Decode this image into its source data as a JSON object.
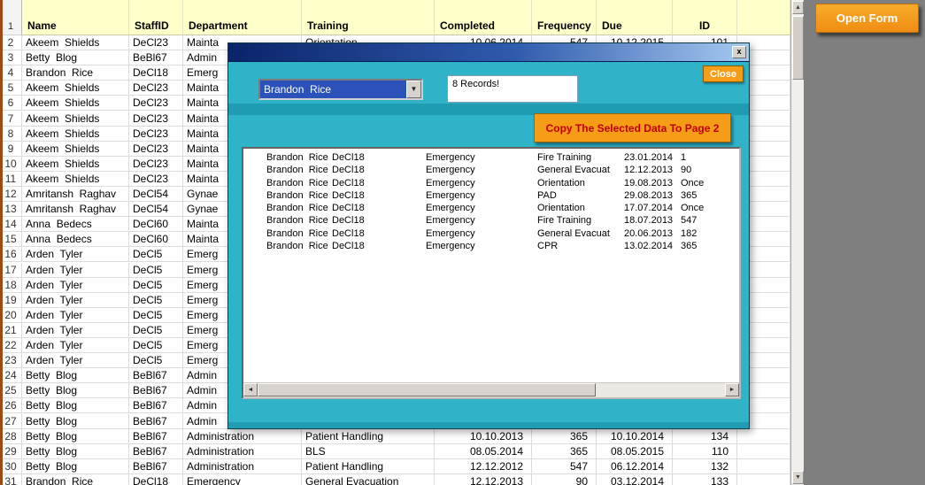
{
  "colors": {
    "accent_orange": "#f59d17",
    "dialog_teal": "#2fb3c9",
    "stripe_teal": "#1f9cb1",
    "selection_blue": "#2a52b8",
    "header_yellow": "#ffffc9",
    "copy_button_text": "#c00000"
  },
  "open_form": {
    "label": "Open Form"
  },
  "sheet": {
    "header_row_num": "1",
    "columns": [
      "Name",
      "StaffID",
      "Department",
      "Training",
      "Completed",
      "Frequency",
      "Due",
      "ID"
    ],
    "rows": [
      {
        "n": "2",
        "name": "Akeem  Shields",
        "staff": "DeCl23",
        "dept": "Mainta",
        "training": "Orientation",
        "completed": "10.06.2014",
        "frequency": "547",
        "due": "10.12.2015",
        "id": "101"
      },
      {
        "n": "3",
        "name": "Betty  Blog",
        "staff": "BeBl67",
        "dept": "Admin",
        "training": "",
        "completed": "",
        "frequency": "",
        "due": "",
        "id": ""
      },
      {
        "n": "4",
        "name": "Brandon  Rice",
        "staff": "DeCl18",
        "dept": "Emerg",
        "training": "",
        "completed": "",
        "frequency": "",
        "due": "",
        "id": ""
      },
      {
        "n": "5",
        "name": "Akeem  Shields",
        "staff": "DeCl23",
        "dept": "Mainta",
        "training": "",
        "completed": "",
        "frequency": "",
        "due": "",
        "id": ""
      },
      {
        "n": "6",
        "name": "Akeem  Shields",
        "staff": "DeCl23",
        "dept": "Mainta",
        "training": "",
        "completed": "",
        "frequency": "",
        "due": "",
        "id": ""
      },
      {
        "n": "7",
        "name": "Akeem  Shields",
        "staff": "DeCl23",
        "dept": "Mainta",
        "training": "",
        "completed": "",
        "frequency": "",
        "due": "",
        "id": ""
      },
      {
        "n": "8",
        "name": "Akeem  Shields",
        "staff": "DeCl23",
        "dept": "Mainta",
        "training": "",
        "completed": "",
        "frequency": "",
        "due": "",
        "id": ""
      },
      {
        "n": "9",
        "name": "Akeem  Shields",
        "staff": "DeCl23",
        "dept": "Mainta",
        "training": "",
        "completed": "",
        "frequency": "",
        "due": "",
        "id": ""
      },
      {
        "n": "10",
        "name": "Akeem  Shields",
        "staff": "DeCl23",
        "dept": "Mainta",
        "training": "",
        "completed": "",
        "frequency": "",
        "due": "",
        "id": ""
      },
      {
        "n": "11",
        "name": "Akeem  Shields",
        "staff": "DeCl23",
        "dept": "Mainta",
        "training": "",
        "completed": "",
        "frequency": "",
        "due": "",
        "id": ""
      },
      {
        "n": "12",
        "name": "Amritansh  Raghav",
        "staff": "DeCl54",
        "dept": "Gynae",
        "training": "",
        "completed": "",
        "frequency": "",
        "due": "",
        "id": ""
      },
      {
        "n": "13",
        "name": "Amritansh  Raghav",
        "staff": "DeCl54",
        "dept": "Gynae",
        "training": "",
        "completed": "",
        "frequency": "",
        "due": "",
        "id": ""
      },
      {
        "n": "14",
        "name": "Anna  Bedecs",
        "staff": "DeCl60",
        "dept": "Mainta",
        "training": "",
        "completed": "",
        "frequency": "",
        "due": "",
        "id": ""
      },
      {
        "n": "15",
        "name": "Anna  Bedecs",
        "staff": "DeCl60",
        "dept": "Mainta",
        "training": "",
        "completed": "",
        "frequency": "",
        "due": "",
        "id": ""
      },
      {
        "n": "16",
        "name": "Arden  Tyler",
        "staff": "DeCl5",
        "dept": "Emerg",
        "training": "",
        "completed": "",
        "frequency": "",
        "due": "",
        "id": ""
      },
      {
        "n": "17",
        "name": "Arden  Tyler",
        "staff": "DeCl5",
        "dept": "Emerg",
        "training": "",
        "completed": "",
        "frequency": "",
        "due": "",
        "id": ""
      },
      {
        "n": "18",
        "name": "Arden  Tyler",
        "staff": "DeCl5",
        "dept": "Emerg",
        "training": "",
        "completed": "",
        "frequency": "",
        "due": "",
        "id": ""
      },
      {
        "n": "19",
        "name": "Arden  Tyler",
        "staff": "DeCl5",
        "dept": "Emerg",
        "training": "",
        "completed": "",
        "frequency": "",
        "due": "",
        "id": ""
      },
      {
        "n": "20",
        "name": "Arden  Tyler",
        "staff": "DeCl5",
        "dept": "Emerg",
        "training": "",
        "completed": "",
        "frequency": "",
        "due": "",
        "id": ""
      },
      {
        "n": "21",
        "name": "Arden  Tyler",
        "staff": "DeCl5",
        "dept": "Emerg",
        "training": "",
        "completed": "",
        "frequency": "",
        "due": "",
        "id": ""
      },
      {
        "n": "22",
        "name": "Arden  Tyler",
        "staff": "DeCl5",
        "dept": "Emerg",
        "training": "",
        "completed": "",
        "frequency": "",
        "due": "",
        "id": ""
      },
      {
        "n": "23",
        "name": "Arden  Tyler",
        "staff": "DeCl5",
        "dept": "Emerg",
        "training": "",
        "completed": "",
        "frequency": "",
        "due": "",
        "id": ""
      },
      {
        "n": "24",
        "name": "Betty  Blog",
        "staff": "BeBl67",
        "dept": "Admin",
        "training": "",
        "completed": "",
        "frequency": "",
        "due": "",
        "id": ""
      },
      {
        "n": "25",
        "name": "Betty  Blog",
        "staff": "BeBl67",
        "dept": "Admin",
        "training": "",
        "completed": "",
        "frequency": "",
        "due": "",
        "id": ""
      },
      {
        "n": "26",
        "name": "Betty  Blog",
        "staff": "BeBl67",
        "dept": "Admin",
        "training": "",
        "completed": "",
        "frequency": "",
        "due": "",
        "id": ""
      },
      {
        "n": "27",
        "name": "Betty  Blog",
        "staff": "BeBl67",
        "dept": "Admin",
        "training": "",
        "completed": "",
        "frequency": "",
        "due": "",
        "id": ""
      },
      {
        "n": "28",
        "name": "Betty  Blog",
        "staff": "BeBl67",
        "dept": "Administration",
        "training": "Patient Handling",
        "completed": "10.10.2013",
        "frequency": "365",
        "due": "10.10.2014",
        "id": "134"
      },
      {
        "n": "29",
        "name": "Betty  Blog",
        "staff": "BeBl67",
        "dept": "Administration",
        "training": "BLS",
        "completed": "08.05.2014",
        "frequency": "365",
        "due": "08.05.2015",
        "id": "110"
      },
      {
        "n": "30",
        "name": "Betty  Blog",
        "staff": "BeBl67",
        "dept": "Administration",
        "training": "Patient Handling",
        "completed": "12.12.2012",
        "frequency": "547",
        "due": "06.12.2014",
        "id": "132"
      },
      {
        "n": "31",
        "name": "Brandon  Rice",
        "staff": "DeCl18",
        "dept": "Emergency",
        "training": "General Evacuation",
        "completed": "12.12.2013",
        "frequency": "90",
        "due": "03.12.2014",
        "id": "133"
      }
    ]
  },
  "dialog": {
    "combo_value": "Brandon  Rice",
    "records_text": "8 Records!",
    "close_label": "Close",
    "close_x": "x",
    "copy_label": "Copy The Selected Data To Page 2",
    "list_rows": [
      {
        "name": "Brandon  Rice",
        "staff": "DeCl18",
        "dept": "Emergency",
        "training": "Fire Training",
        "date": "23.01.2014",
        "freq": "1"
      },
      {
        "name": "Brandon  Rice",
        "staff": "DeCl18",
        "dept": "Emergency",
        "training": "General Evacuat",
        "date": "12.12.2013",
        "freq": "90"
      },
      {
        "name": "Brandon  Rice",
        "staff": "DeCl18",
        "dept": "Emergency",
        "training": "Orientation",
        "date": "19.08.2013",
        "freq": "Once"
      },
      {
        "name": "Brandon  Rice",
        "staff": "DeCl18",
        "dept": "Emergency",
        "training": "PAD",
        "date": "29.08.2013",
        "freq": "365"
      },
      {
        "name": "Brandon  Rice",
        "staff": "DeCl18",
        "dept": "Emergency",
        "training": "Orientation",
        "date": "17.07.2014",
        "freq": "Once"
      },
      {
        "name": "Brandon  Rice",
        "staff": "DeCl18",
        "dept": "Emergency",
        "training": "Fire Training",
        "date": "18.07.2013",
        "freq": "547"
      },
      {
        "name": "Brandon  Rice",
        "staff": "DeCl18",
        "dept": "Emergency",
        "training": "General Evacuat",
        "date": "20.06.2013",
        "freq": "182"
      },
      {
        "name": "Brandon  Rice",
        "staff": "DeCl18",
        "dept": "Emergency",
        "training": "CPR",
        "date": "13.02.2014",
        "freq": "365"
      }
    ]
  }
}
